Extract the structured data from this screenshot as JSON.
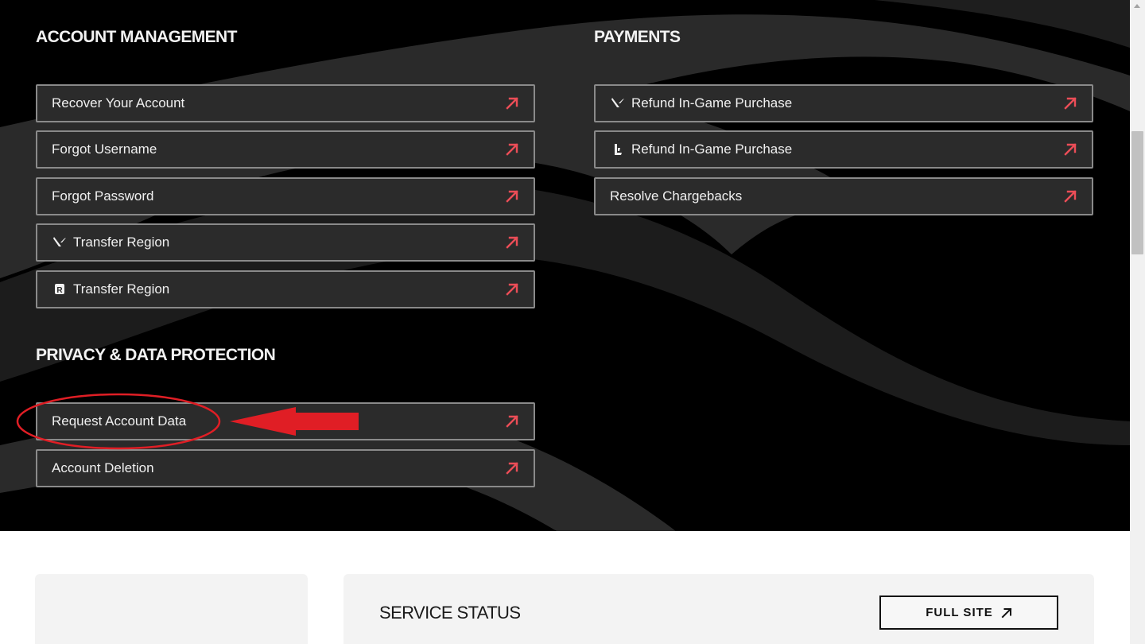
{
  "sections": {
    "account_management": {
      "heading": "ACCOUNT MANAGEMENT",
      "items": [
        {
          "label": "Recover Your Account",
          "icon": null
        },
        {
          "label": "Forgot Username",
          "icon": null
        },
        {
          "label": "Forgot Password",
          "icon": null
        },
        {
          "label": "Transfer Region",
          "icon": "valorant-icon"
        },
        {
          "label": "Transfer Region",
          "icon": "riot-client-icon"
        }
      ]
    },
    "payments": {
      "heading": "PAYMENTS",
      "items": [
        {
          "label": "Refund In-Game Purchase",
          "icon": "valorant-icon"
        },
        {
          "label": "Refund In-Game Purchase",
          "icon": "lol-icon"
        },
        {
          "label": "Resolve Chargebacks",
          "icon": null
        }
      ]
    },
    "privacy": {
      "heading": "PRIVACY & DATA PROTECTION",
      "items": [
        {
          "label": "Request Account Data",
          "icon": null
        },
        {
          "label": "Account Deletion",
          "icon": null
        }
      ]
    }
  },
  "service_status": {
    "title": "SERVICE STATUS",
    "full_site_label": "FULL SITE"
  },
  "colors": {
    "background_dark": "#000000",
    "button_bg": "#2b2b2b",
    "button_border": "#8a8a8a",
    "accent_arrow": "#eb4d57",
    "annotation_red": "#e01e25"
  }
}
